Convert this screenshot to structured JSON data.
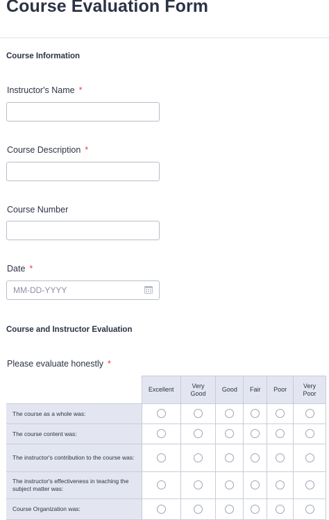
{
  "form": {
    "title": "Course Evaluation Form"
  },
  "course_information": {
    "heading": "Course Information",
    "fields": [
      {
        "label": "Instructor's Name",
        "required": true,
        "value": ""
      },
      {
        "label": "Course Description",
        "required": true,
        "value": ""
      },
      {
        "label": "Course Number",
        "required": false,
        "value": ""
      },
      {
        "label": "Date",
        "required": true,
        "value": "",
        "placeholder": "MM-DD-YYYY"
      }
    ],
    "required_mark": "*"
  },
  "evaluation": {
    "heading": "Course and Instructor Evaluation",
    "question_label": "Please evaluate honestly",
    "required_mark": "*",
    "columns": [
      "Excellent",
      "Very Good",
      "Good",
      "Fair",
      "Poor",
      "Very Poor"
    ],
    "rows": [
      "The course as a whole was:",
      "The course content was:",
      "The instructor's contribution to the course was:",
      "The instructor's effectiveness in teaching the subject matter was:",
      "Course Organization was:"
    ]
  },
  "icons": {
    "date_picker": "calendar-icon",
    "radio": "radio-circle-icon"
  },
  "colors": {
    "text": "#2c3345",
    "required": "#f23a3c",
    "input_border": "#b8bdc9",
    "matrix_header_bg": "#e3e6f1",
    "matrix_border": "#c8ccd8",
    "placeholder": "#8d8fa8"
  }
}
